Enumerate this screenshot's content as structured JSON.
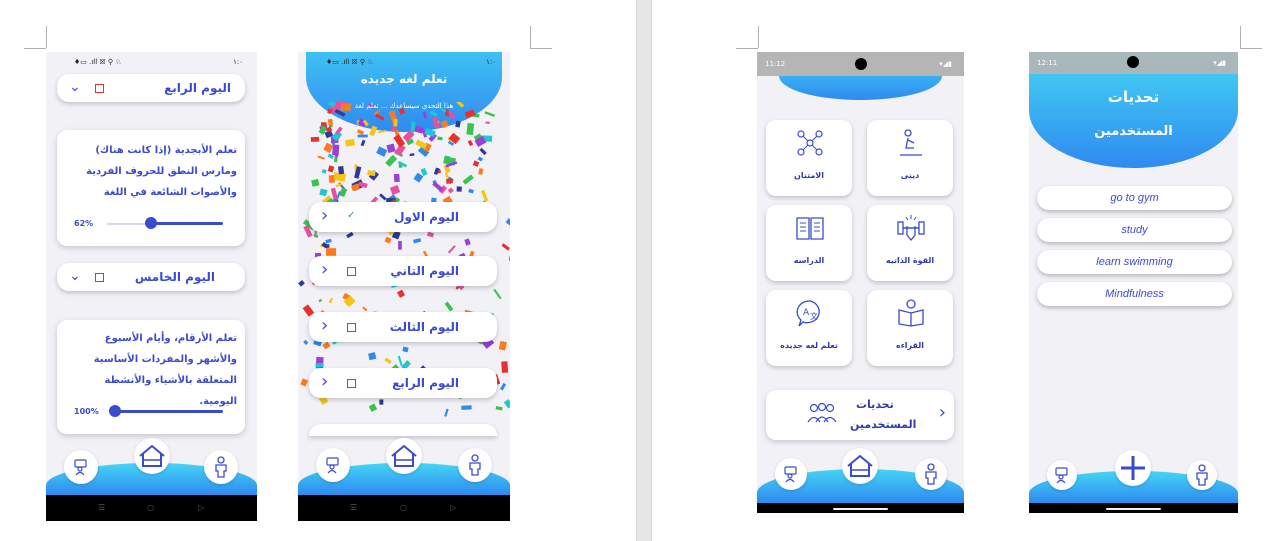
{
  "phone1": {
    "status_left": "♦▭ .ıll ☒ ⚲ ♘",
    "status_right": "١:٠",
    "day4_title": "اليوم الرابع",
    "day4_text": "تعلم الأبجدية (إذا كانت هناك) ومارس النطق للحروف الفردية والأصوات الشائعة في اللغة",
    "day4_percent": "62%",
    "day4_progress": 0.62,
    "day5_title": "اليوم الخامس",
    "day5_text": "تعلم الأرقام، وأيام الأسبوع والأشهر والمفردات الأساسية المتعلقة بالأشياء والأنشطة اليومية.",
    "day5_percent": "100%",
    "day5_progress": 1.0
  },
  "phone2": {
    "status_left": "♦▭ .ıll ☒ ⚲ ♘",
    "status_right": "١:٠",
    "header_title": "تعلم لغه جديده",
    "header_sub": "هذا التحدي سيساعدك ... تعلم لغة",
    "days": [
      {
        "title": "اليوم الاول",
        "done": true
      },
      {
        "title": "اليوم التاني",
        "done": false
      },
      {
        "title": "اليوم الثالث",
        "done": false
      },
      {
        "title": "اليوم الرابع",
        "done": false
      }
    ]
  },
  "phone3": {
    "status_time": "11:12",
    "tiles": [
      {
        "label": "الامتنان",
        "icon": "network-people-icon"
      },
      {
        "label": "دينى",
        "icon": "praying-person-icon"
      },
      {
        "label": "الدراسه",
        "icon": "open-book-icon"
      },
      {
        "label": "القوة الذاتيه",
        "icon": "strength-dumbbell-icon"
      },
      {
        "label": "تعلم لغه جديده",
        "icon": "translate-icon"
      },
      {
        "label": "القراءه",
        "icon": "reading-person-icon"
      }
    ],
    "user_challenges_label_1": "تحديات",
    "user_challenges_label_2": "المستخدمين"
  },
  "phone4": {
    "status_time": "12:11",
    "header_line_1": "تحديات",
    "header_line_2": "المستخدمين",
    "items": [
      "go to gym",
      "study",
      "learn swimming",
      "Mindfulness"
    ]
  },
  "colors": {
    "accent": "#3a4bd0",
    "wave_top": "#45d5f5",
    "wave_bottom": "#2f8af0",
    "checkbox_red": "#e03030",
    "check_green": "#2ea84a"
  }
}
